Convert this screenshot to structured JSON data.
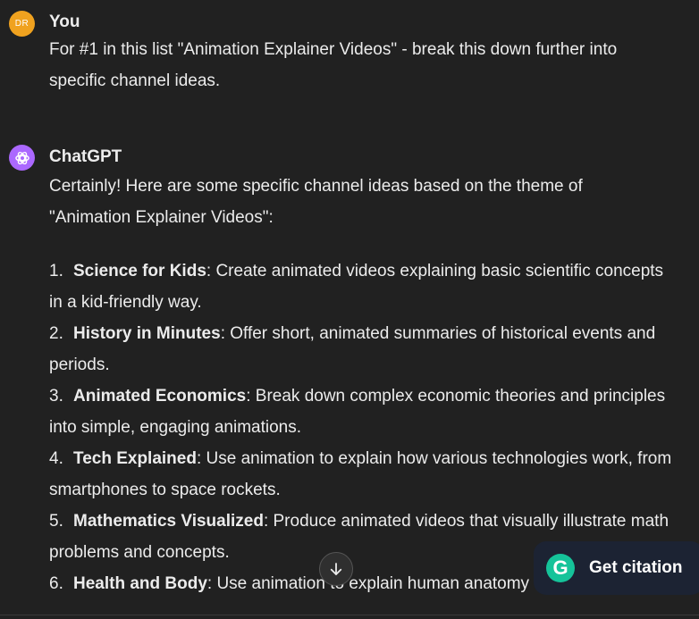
{
  "user_message": {
    "avatar_initials": "DR",
    "author": "You",
    "lines": [
      "For #1 in this list \"Animation Explainer Videos\" - break this down further into",
      "specific channel ideas."
    ]
  },
  "assistant_message": {
    "author": "ChatGPT",
    "intro_lines": [
      "Certainly! Here are some specific channel ideas based on the theme of",
      "\"Animation Explainer Videos\":"
    ],
    "items": [
      {
        "num": "1.",
        "title": "Science for Kids",
        "line1": ": Create animated videos explaining basic scientific concepts",
        "line2": "in a kid-friendly way."
      },
      {
        "num": "2.",
        "title": "History in Minutes",
        "line1": ": Offer short, animated summaries of historical events and",
        "line2": "periods."
      },
      {
        "num": "3.",
        "title": "Animated Economics",
        "line1": ": Break down complex economic theories and principles",
        "line2": "into simple, engaging animations."
      },
      {
        "num": "4.",
        "title": "Tech Explained",
        "line1": ": Use animation to explain how various technologies work, from",
        "line2": "smartphones to space rockets."
      },
      {
        "num": "5.",
        "title": "Mathematics Visualized",
        "line1": ": Produce animated videos that visually illustrate math",
        "line2": "problems and concepts."
      },
      {
        "num": "6.",
        "title": "Health and Body",
        "line1": ": Use animation to explain human anatomy",
        "line2": ""
      }
    ]
  },
  "scroll_button_icon": "arrow-down-icon",
  "citation_button": {
    "logo": "G",
    "label": "Get citation",
    "color": "#15c39a"
  },
  "colors": {
    "background": "#212121",
    "user_avatar": "#f0a21f",
    "gpt_avatar": "#ab68ff"
  }
}
